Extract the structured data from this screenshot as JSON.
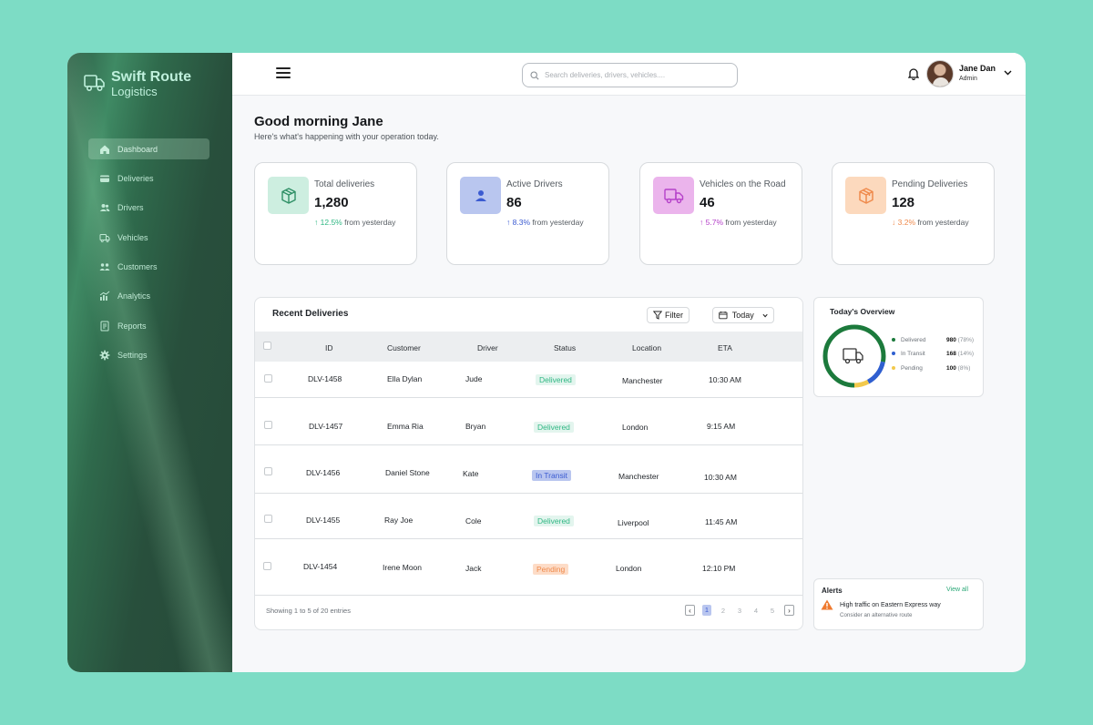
{
  "brand": {
    "title": "Swift Route",
    "subtitle": "Logistics"
  },
  "sidebar": {
    "items": [
      {
        "label": "Dashboard",
        "icon": "home-icon",
        "active": true
      },
      {
        "label": "Deliveries",
        "icon": "card-icon"
      },
      {
        "label": "Drivers",
        "icon": "users-icon"
      },
      {
        "label": "Vehicles",
        "icon": "truck-icon"
      },
      {
        "label": "Customers",
        "icon": "customers-icon"
      },
      {
        "label": "Analytics",
        "icon": "chart-icon"
      },
      {
        "label": "Reports",
        "icon": "report-icon"
      },
      {
        "label": "Settings",
        "icon": "gear-icon"
      }
    ]
  },
  "header": {
    "search_placeholder": "Search deliveries, drivers, vehicles....",
    "user_name": "Jane Dan",
    "user_role": "Admin"
  },
  "greeting": {
    "title": "Good morning Jane",
    "subtitle": "Here's what's happening with your operation today."
  },
  "stats": [
    {
      "label": "Total deliveries",
      "value": "1,280",
      "change": "12.5%",
      "direction": "up",
      "suffix": "from yesterday",
      "color": "#2fb783",
      "icon_bg": "#cdeee0",
      "icon_color": "#2f8f66"
    },
    {
      "label": "Active Drivers",
      "value": "86",
      "change": "8.3%",
      "direction": "up",
      "suffix": "from yesterday",
      "color": "#3b5bd1",
      "icon_bg": "#b9c6ef",
      "icon_color": "#3b5bd1"
    },
    {
      "label": "Vehicles on the Road",
      "value": "46",
      "change": "5.7%",
      "direction": "up",
      "suffix": "from yesterday",
      "color": "#b541c9",
      "icon_bg": "#ebb4ec",
      "icon_color": "#b541c9"
    },
    {
      "label": "Pending Deliveries",
      "value": "128",
      "change": "3.2%",
      "direction": "down",
      "suffix": "from yesterday",
      "color": "#ef8a4c",
      "icon_bg": "#fcd9bd",
      "icon_color": "#ef8a4c"
    }
  ],
  "deliveries": {
    "title": "Recent Deliveries",
    "filter_label": "Filter",
    "date_label": "Today",
    "columns": [
      "ID",
      "Customer",
      "Driver",
      "Status",
      "Location",
      "ETA"
    ],
    "rows": [
      {
        "id": "DLV-1458",
        "customer": "Ella Dylan",
        "driver": "Jude",
        "status": "Delivered",
        "status_type": "delivered",
        "location": "Manchester",
        "eta": "10:30 AM"
      },
      {
        "id": "DLV-1457",
        "customer": "Emma Ria",
        "driver": "Bryan",
        "status": "Delivered",
        "status_type": "delivered",
        "location": "London",
        "eta": "9:15 AM"
      },
      {
        "id": "DLV-1456",
        "customer": "Daniel Stone",
        "driver": "Kate",
        "status": "In Transit",
        "status_type": "transit",
        "location": "Manchester",
        "eta": "10:30 AM"
      },
      {
        "id": "DLV-1455",
        "customer": "Ray Joe",
        "driver": "Cole",
        "status": "Delivered",
        "status_type": "delivered",
        "location": "Liverpool",
        "eta": "11:45 AM"
      },
      {
        "id": "DLV-1454",
        "customer": "Irene Moon",
        "driver": "Jack",
        "status": "Pending",
        "status_type": "pending",
        "location": "London",
        "eta": "12:10 PM"
      }
    ],
    "showing": "Showing 1 to 5 of 20 entries",
    "pages": [
      "1",
      "2",
      "3",
      "4",
      "5"
    ],
    "current_page": "1"
  },
  "overview": {
    "title": "Today's Overview",
    "items": [
      {
        "label": "Delivered",
        "value": "980",
        "percent": "(78%)",
        "fraction": 0.78,
        "color": "#1c7a3c"
      },
      {
        "label": "In Transit",
        "value": "168",
        "percent": "(14%)",
        "fraction": 0.14,
        "color": "#2f5fd0"
      },
      {
        "label": "Pending",
        "value": "100",
        "percent": "(8%)",
        "fraction": 0.08,
        "color": "#f2c94c"
      }
    ]
  },
  "alerts": {
    "title": "Alerts",
    "view_all": "View all",
    "message": "High traffic on Eastern Express way",
    "hint": "Consider an alternative route"
  }
}
